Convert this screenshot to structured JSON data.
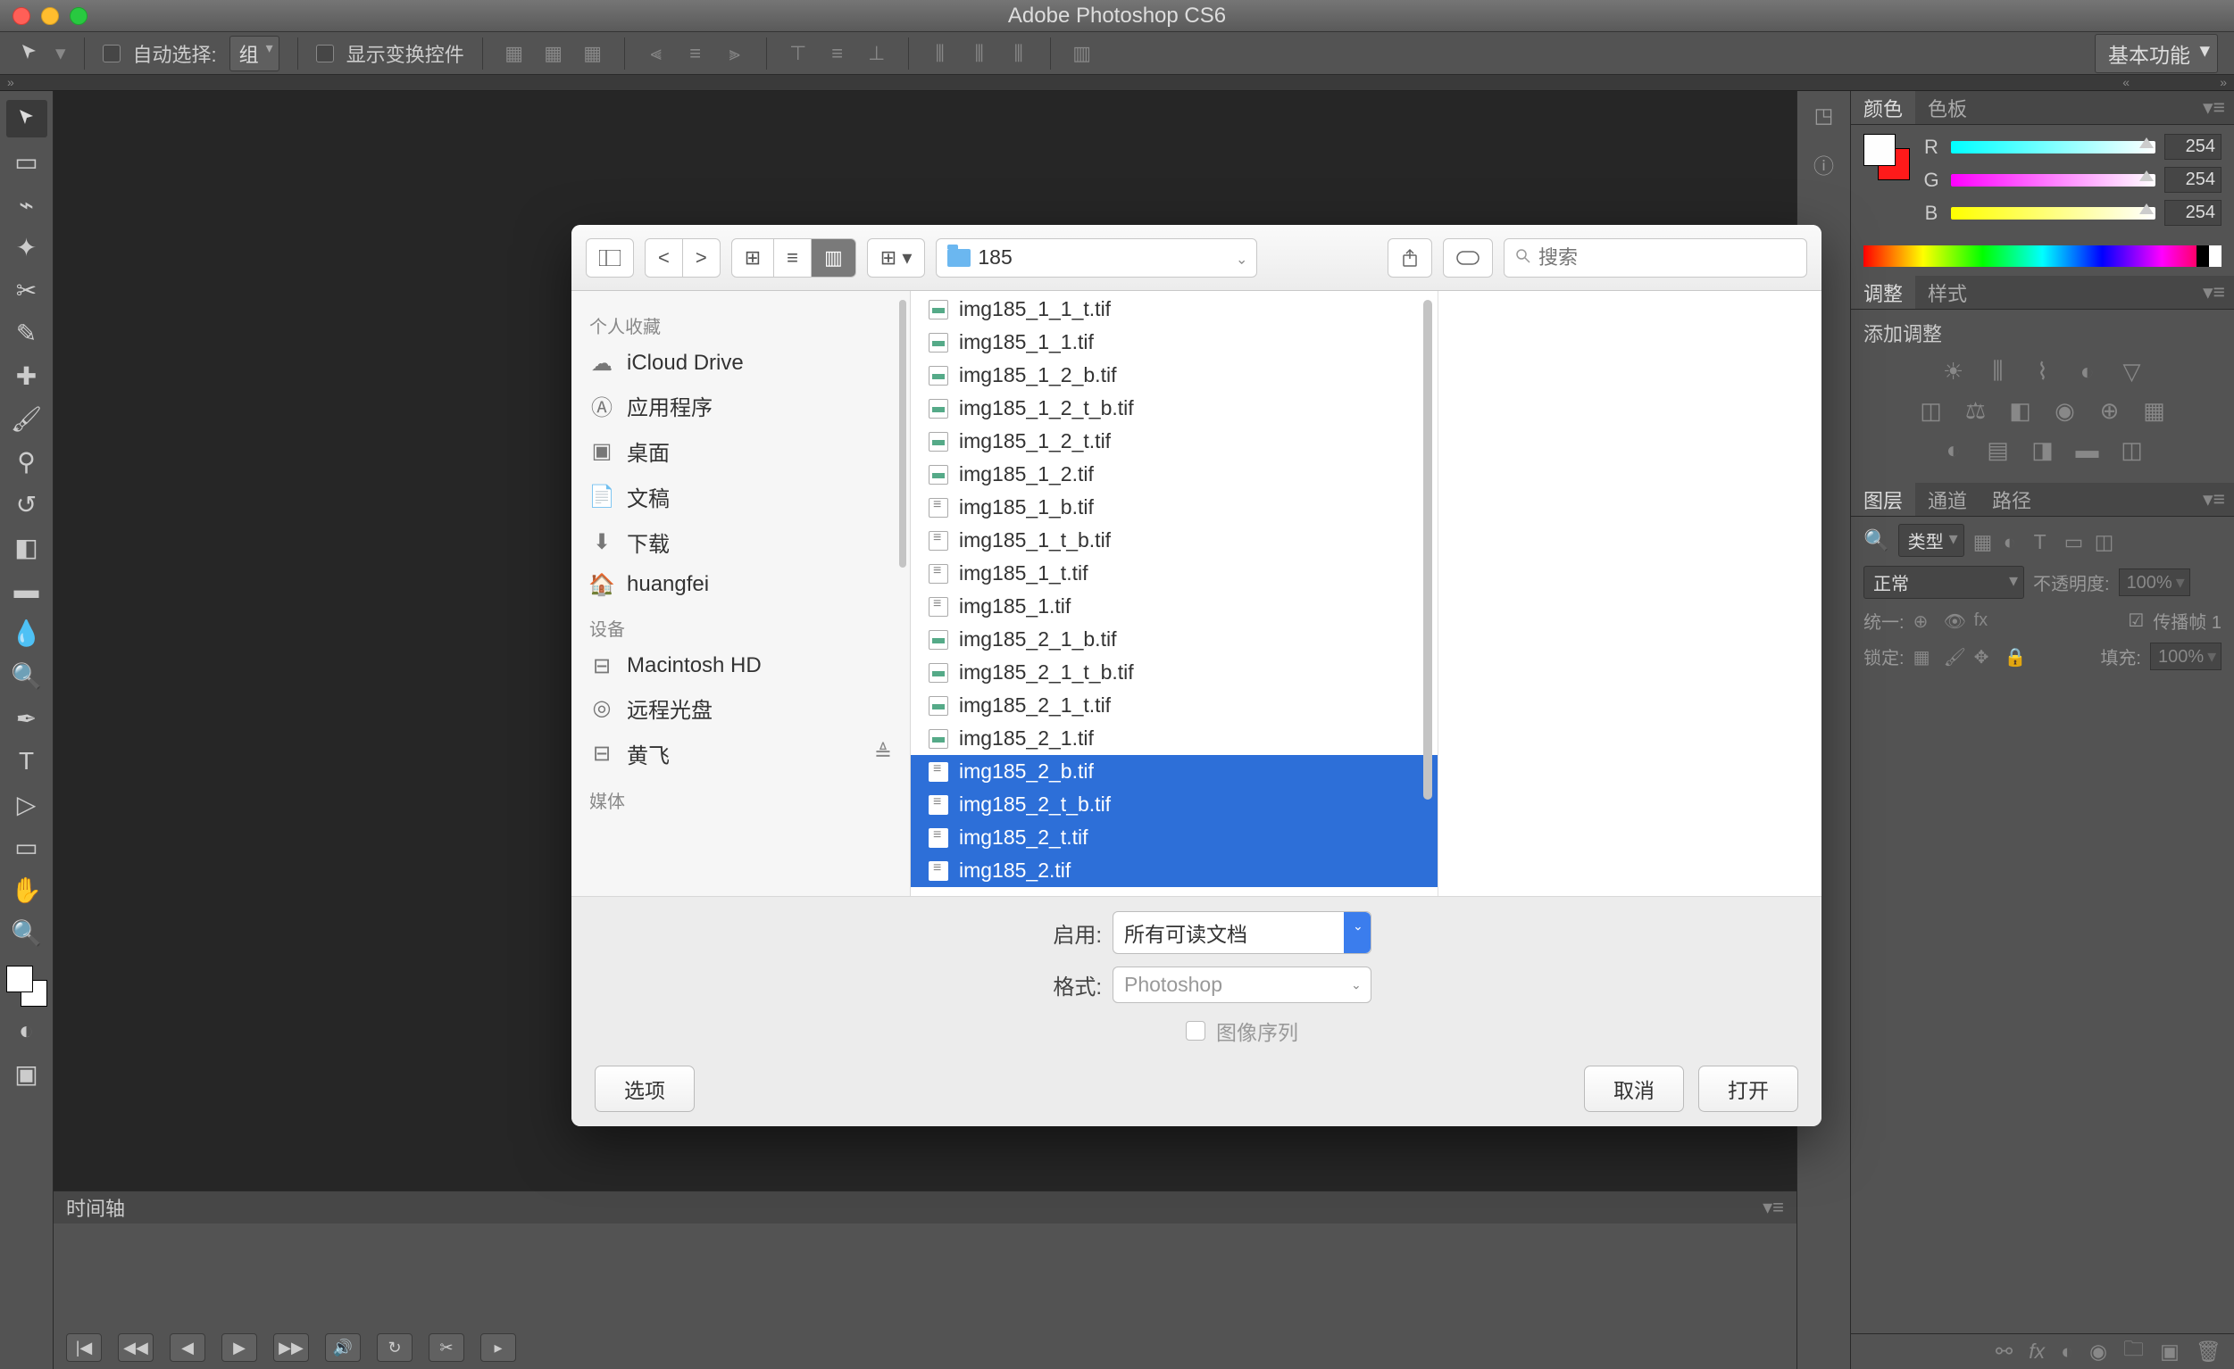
{
  "app": {
    "title": "Adobe Photoshop CS6"
  },
  "optbar": {
    "auto_select": "自动选择:",
    "group": "组",
    "show_transform": "显示变换控件",
    "workspace": "基本功能"
  },
  "panels": {
    "color_tab": "颜色",
    "swatches_tab": "色板",
    "r_label": "R",
    "r_value": "254",
    "g_label": "G",
    "g_value": "254",
    "b_label": "B",
    "b_value": "254",
    "adjust_tab": "调整",
    "styles_tab": "样式",
    "add_adjust": "添加调整",
    "layers_tab": "图层",
    "channels_tab": "通道",
    "paths_tab": "路径",
    "kind": "类型",
    "blend": "正常",
    "opacity_label": "不透明度:",
    "opacity_value": "100%",
    "unify_label": "统一:",
    "propagate": "传播帧 1",
    "lock_label": "锁定:",
    "fill_label": "填充:",
    "fill_value": "100%"
  },
  "timeline": {
    "tab": "时间轴"
  },
  "dialog": {
    "path_folder": "185",
    "search_placeholder": "搜索",
    "favorites": "个人收藏",
    "devices": "设备",
    "media": "媒体",
    "sidebar_fav": [
      "iCloud Drive",
      "应用程序",
      "桌面",
      "文稿",
      "下载",
      "huangfei"
    ],
    "sidebar_dev": [
      "Macintosh HD",
      "远程光盘",
      "黄飞"
    ],
    "files": [
      {
        "n": "img185_1_1_t.tif",
        "t": "img",
        "s": false
      },
      {
        "n": "img185_1_1.tif",
        "t": "img",
        "s": false
      },
      {
        "n": "img185_1_2_b.tif",
        "t": "img",
        "s": false
      },
      {
        "n": "img185_1_2_t_b.tif",
        "t": "img",
        "s": false
      },
      {
        "n": "img185_1_2_t.tif",
        "t": "img",
        "s": false
      },
      {
        "n": "img185_1_2.tif",
        "t": "img",
        "s": false
      },
      {
        "n": "img185_1_b.tif",
        "t": "txt",
        "s": false
      },
      {
        "n": "img185_1_t_b.tif",
        "t": "txt",
        "s": false
      },
      {
        "n": "img185_1_t.tif",
        "t": "txt",
        "s": false
      },
      {
        "n": "img185_1.tif",
        "t": "txt",
        "s": false
      },
      {
        "n": "img185_2_1_b.tif",
        "t": "img",
        "s": false
      },
      {
        "n": "img185_2_1_t_b.tif",
        "t": "img",
        "s": false
      },
      {
        "n": "img185_2_1_t.tif",
        "t": "img",
        "s": false
      },
      {
        "n": "img185_2_1.tif",
        "t": "img",
        "s": false
      },
      {
        "n": "img185_2_b.tif",
        "t": "txt",
        "s": true
      },
      {
        "n": "img185_2_t_b.tif",
        "t": "txt",
        "s": true
      },
      {
        "n": "img185_2_t.tif",
        "t": "txt",
        "s": true
      },
      {
        "n": "img185_2.tif",
        "t": "txt",
        "s": true
      }
    ],
    "enable_label": "启用:",
    "enable_value": "所有可读文档",
    "format_label": "格式:",
    "format_value": "Photoshop",
    "sequence": "图像序列",
    "options": "选项",
    "cancel": "取消",
    "open": "打开"
  }
}
